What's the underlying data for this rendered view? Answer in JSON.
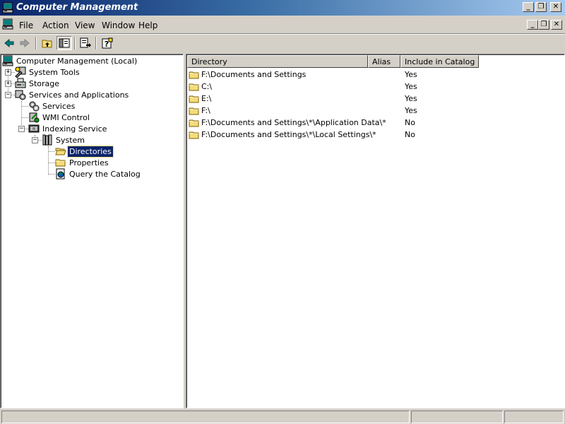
{
  "window": {
    "title": "Computer Management",
    "caption_minimize": "_",
    "caption_restore": "❐",
    "caption_close": "✕"
  },
  "menu": {
    "items": [
      "File",
      "Action",
      "View",
      "Window",
      "Help"
    ],
    "mdi_minimize": "_",
    "mdi_restore": "❐",
    "mdi_close": "✕"
  },
  "toolbar": {
    "icons": [
      "back-arrow-icon",
      "forward-arrow-icon",
      "up-folder-icon",
      "show-hide-tree-icon",
      "export-list-icon",
      "help-icon"
    ]
  },
  "tree": {
    "root": "Computer Management (Local)",
    "system_tools": "System Tools",
    "storage": "Storage",
    "services_apps": "Services and Applications",
    "services": "Services",
    "wmi": "WMI Control",
    "indexing": "Indexing Service",
    "system": "System",
    "directories": "Directories",
    "properties": "Properties",
    "query": "Query the Catalog",
    "expand_plus": "+",
    "collapse_minus": "−"
  },
  "list": {
    "columns": [
      "Directory",
      "Alias",
      "Include in Catalog"
    ],
    "rows": [
      {
        "directory": "F:\\Documents and Settings",
        "alias": "",
        "include": "Yes"
      },
      {
        "directory": "C:\\",
        "alias": "",
        "include": "Yes"
      },
      {
        "directory": "E:\\",
        "alias": "",
        "include": "Yes"
      },
      {
        "directory": "F:\\",
        "alias": "",
        "include": "Yes"
      },
      {
        "directory": "F:\\Documents and Settings\\*\\Application Data\\*",
        "alias": "",
        "include": "No"
      },
      {
        "directory": "F:\\Documents and Settings\\*\\Local Settings\\*",
        "alias": "",
        "include": "No"
      }
    ]
  },
  "colors": {
    "title_gradient_start": "#0a246a",
    "title_gradient_end": "#a6caf0",
    "selection": "#0a246a",
    "folder": "#f5dc7a"
  }
}
